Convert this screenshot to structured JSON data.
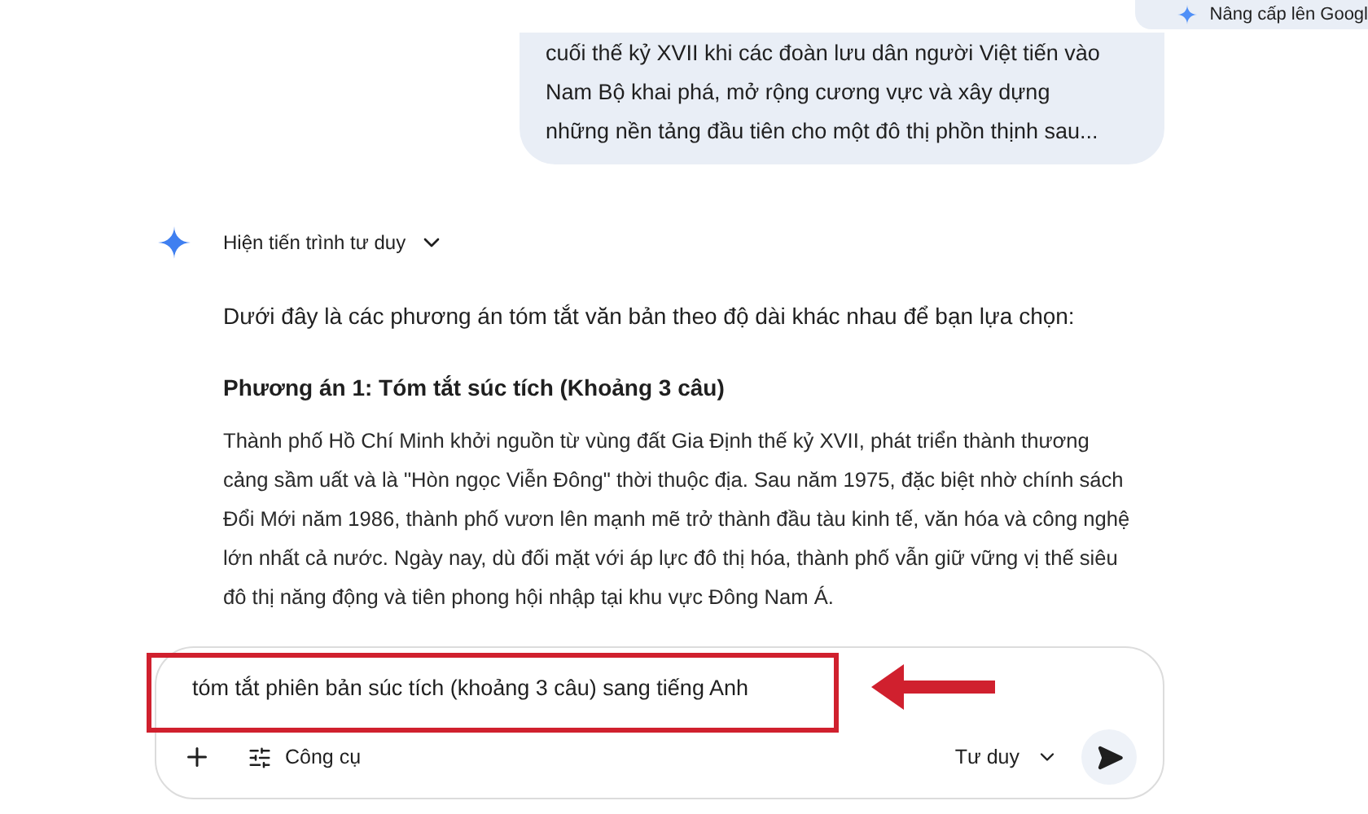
{
  "upgrade_button": {
    "label": "Nâng cấp lên Googl"
  },
  "user_message": {
    "lines": [
      "cuối thế kỷ XVII khi các đoàn lưu dân người Việt tiến vào",
      "Nam Bộ khai phá, mở rộng cương vực và xây dựng",
      "những nền tảng đầu tiên cho một đô thị phồn thịnh sau..."
    ]
  },
  "response": {
    "thinking_toggle": {
      "label": "Hiện tiến trình tư duy",
      "expanded": false
    },
    "intro": "Dưới đây là các phương án tóm tắt văn bản theo độ dài khác nhau để bạn lựa chọn:",
    "heading": "Phương án 1: Tóm tắt súc tích (Khoảng 3 câu)",
    "paragraph": "Thành phố Hồ Chí Minh khởi nguồn từ vùng đất Gia Định thế kỷ XVII, phát triển thành thương cảng sầm uất và là \"Hòn ngọc Viễn Đông\" thời thuộc địa. Sau năm 1975, đặc biệt nhờ chính sách Đổi Mới năm 1986, thành phố vươn lên mạnh mẽ trở thành đầu tàu kinh tế, văn hóa và công nghệ lớn nhất cả nước. Ngày nay, dù đối mặt với áp lực đô thị hóa, thành phố vẫn giữ vững vị thế siêu đô thị năng động và tiên phong hội nhập tại khu vực Đông Nam Á."
  },
  "composer": {
    "value": "tóm tắt phiên bản súc tích (khoảng 3 câu) sang tiếng Anh",
    "tools_label": "Công cụ",
    "mode_label": "Tư duy"
  }
}
